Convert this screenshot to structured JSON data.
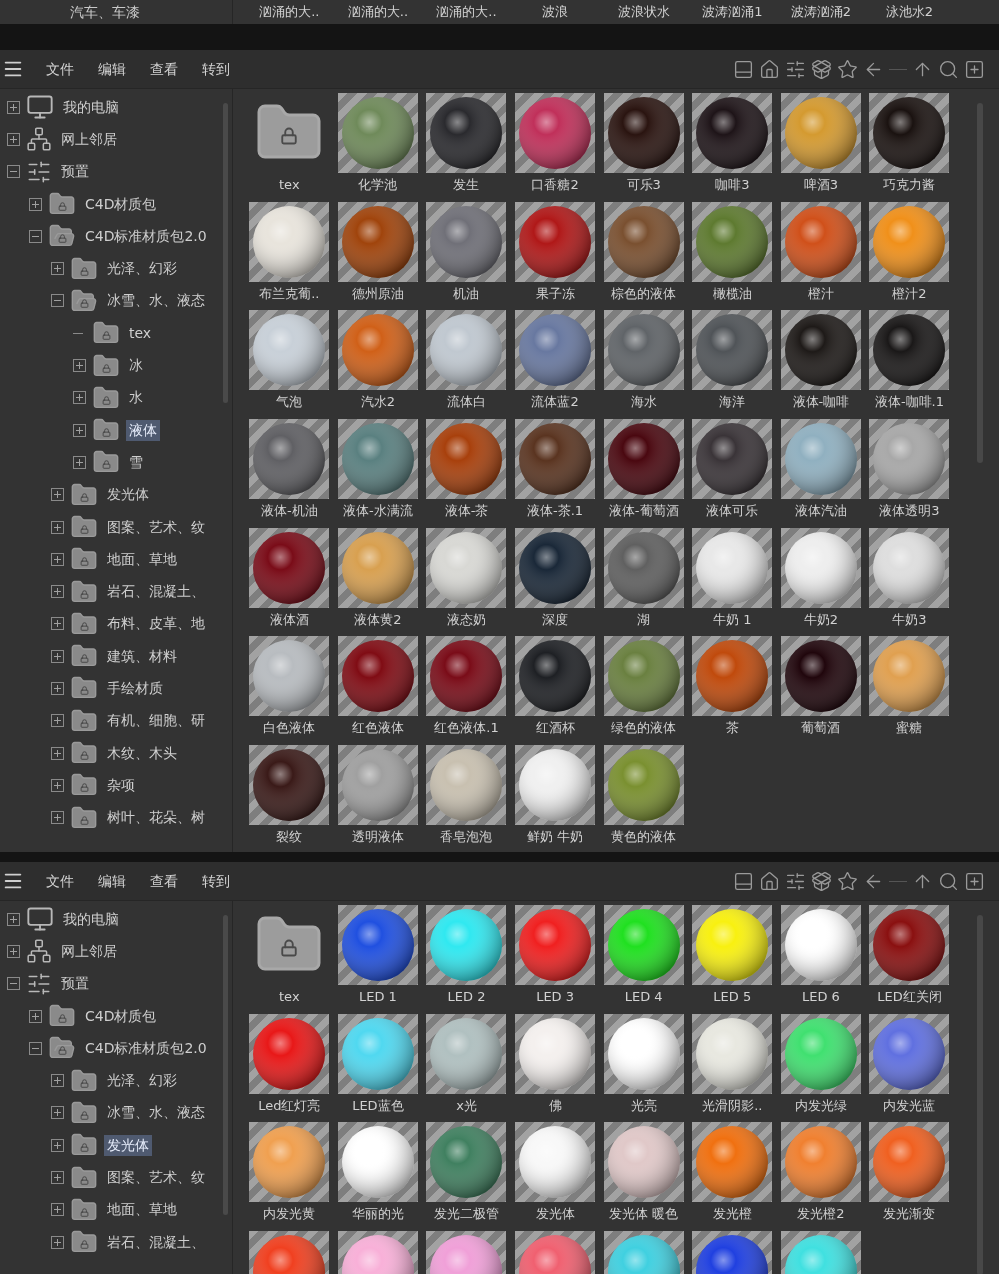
{
  "top_strip": {
    "tree_item": "汽车、车漆",
    "labels": [
      "汹涌的大..",
      "汹涌的大..",
      "汹涌的大..",
      "波浪",
      "波浪状水",
      "波涛汹涌1",
      "波涛汹涌2",
      "泳池水2"
    ]
  },
  "panels": [
    {
      "menu": [
        "文件",
        "编辑",
        "查看",
        "转到"
      ],
      "tree": [
        {
          "label": "我的电脑",
          "kind": "computer",
          "expandable": true,
          "expanded": false,
          "selected": false
        },
        {
          "label": "网上邻居",
          "kind": "network",
          "expandable": true,
          "expanded": false,
          "selected": false
        },
        {
          "label": "预置",
          "kind": "presets",
          "expandable": true,
          "expanded": true,
          "selected": false,
          "children": [
            {
              "label": "C4D材质包",
              "kind": "folder",
              "expandable": true,
              "expanded": false,
              "selected": false
            },
            {
              "label": "C4D标准材质包2.0",
              "kind": "folder",
              "expandable": true,
              "expanded": true,
              "selected": false,
              "children": [
                {
                  "label": "光泽、幻彩",
                  "kind": "folder",
                  "expandable": true,
                  "expanded": false,
                  "selected": false
                },
                {
                  "label": "冰雪、水、液态",
                  "kind": "folder",
                  "expandable": true,
                  "expanded": true,
                  "selected": false,
                  "children": [
                    {
                      "label": "tex",
                      "kind": "folder",
                      "expandable": false,
                      "expanded": false,
                      "selected": false
                    },
                    {
                      "label": "冰",
                      "kind": "folder",
                      "expandable": true,
                      "expanded": false,
                      "selected": false
                    },
                    {
                      "label": "水",
                      "kind": "folder",
                      "expandable": true,
                      "expanded": false,
                      "selected": false
                    },
                    {
                      "label": "液体",
                      "kind": "folder",
                      "expandable": true,
                      "expanded": false,
                      "selected": true
                    },
                    {
                      "label": "雪",
                      "kind": "folder",
                      "expandable": true,
                      "expanded": false,
                      "selected": false
                    }
                  ]
                },
                {
                  "label": "发光体",
                  "kind": "folder",
                  "expandable": true,
                  "expanded": false,
                  "selected": false
                },
                {
                  "label": "图案、艺术、纹",
                  "kind": "folder",
                  "expandable": true,
                  "expanded": false,
                  "selected": false
                },
                {
                  "label": "地面、草地",
                  "kind": "folder",
                  "expandable": true,
                  "expanded": false,
                  "selected": false
                },
                {
                  "label": "岩石、混凝土、",
                  "kind": "folder",
                  "expandable": true,
                  "expanded": false,
                  "selected": false
                },
                {
                  "label": "布料、皮革、地",
                  "kind": "folder",
                  "expandable": true,
                  "expanded": false,
                  "selected": false
                },
                {
                  "label": "建筑、材料",
                  "kind": "folder",
                  "expandable": true,
                  "expanded": false,
                  "selected": false
                },
                {
                  "label": "手绘材质",
                  "kind": "folder",
                  "expandable": true,
                  "expanded": false,
                  "selected": false
                },
                {
                  "label": "有机、细胞、研",
                  "kind": "folder",
                  "expandable": true,
                  "expanded": false,
                  "selected": false
                },
                {
                  "label": "木纹、木头",
                  "kind": "folder",
                  "expandable": true,
                  "expanded": false,
                  "selected": false
                },
                {
                  "label": "杂项",
                  "kind": "folder",
                  "expandable": true,
                  "expanded": false,
                  "selected": false
                },
                {
                  "label": "树叶、花朵、树",
                  "kind": "folder",
                  "expandable": true,
                  "expanded": false,
                  "selected": false
                }
              ]
            }
          ]
        }
      ],
      "grid": [
        {
          "name": "tex",
          "kind": "folder"
        },
        {
          "name": "化学池",
          "kind": "material",
          "color": "#6f8a5a"
        },
        {
          "name": "发生",
          "kind": "material",
          "color": "#2a2a2e"
        },
        {
          "name": "口香糖2",
          "kind": "material",
          "color": "#c0305a"
        },
        {
          "name": "可乐3",
          "kind": "material",
          "color": "#2a1410"
        },
        {
          "name": "咖啡3",
          "kind": "material",
          "color": "#1e1418"
        },
        {
          "name": "啤酒3",
          "kind": "material",
          "color": "#d49a30"
        },
        {
          "name": "巧克力酱",
          "kind": "material",
          "color": "#1a1210"
        },
        {
          "name": "布兰克葡..",
          "kind": "material",
          "color": "#e8e4dc"
        },
        {
          "name": "德州原油",
          "kind": "material",
          "color": "#a0440c"
        },
        {
          "name": "机油",
          "kind": "material",
          "color": "#707078"
        },
        {
          "name": "果子冻",
          "kind": "material",
          "color": "#b01818"
        },
        {
          "name": "棕色的液体",
          "kind": "material",
          "color": "#7a5030"
        },
        {
          "name": "橄榄油",
          "kind": "material",
          "color": "#5e7a30"
        },
        {
          "name": "橙汁",
          "kind": "material",
          "color": "#d0501a"
        },
        {
          "name": "橙汁2",
          "kind": "material",
          "color": "#f0901a"
        },
        {
          "name": "气泡",
          "kind": "material",
          "color": "#c8d0d8"
        },
        {
          "name": "汽水2",
          "kind": "material",
          "color": "#d06018"
        },
        {
          "name": "流体白",
          "kind": "material",
          "color": "#c0c8d0"
        },
        {
          "name": "流体蓝2",
          "kind": "material",
          "color": "#6878a0"
        },
        {
          "name": "海水",
          "kind": "material",
          "color": "#606468"
        },
        {
          "name": "海洋",
          "kind": "material",
          "color": "#505458"
        },
        {
          "name": "液体-咖啡",
          "kind": "material",
          "color": "#1e1a18"
        },
        {
          "name": "液体-咖啡.1",
          "kind": "material",
          "color": "#1a1818"
        },
        {
          "name": "液体-机油",
          "kind": "material",
          "color": "#606064"
        },
        {
          "name": "液体-水满流",
          "kind": "material",
          "color": "#5a8080"
        },
        {
          "name": "液体-茶",
          "kind": "material",
          "color": "#a8400c"
        },
        {
          "name": "液体-茶.1",
          "kind": "material",
          "color": "#5a3420"
        },
        {
          "name": "液体-葡萄酒",
          "kind": "material",
          "color": "#4a0810"
        },
        {
          "name": "液体可乐",
          "kind": "material",
          "color": "#3a3438"
        },
        {
          "name": "液体汽油",
          "kind": "material",
          "color": "#90b0c0"
        },
        {
          "name": "液体透明3",
          "kind": "material",
          "color": "#a8a8a8"
        },
        {
          "name": "液体酒",
          "kind": "material",
          "color": "#7a0c18"
        },
        {
          "name": "液体黄2",
          "kind": "material",
          "color": "#d8a050"
        },
        {
          "name": "液态奶",
          "kind": "material",
          "color": "#d8d8d4"
        },
        {
          "name": "深度",
          "kind": "material",
          "color": "#1a2838"
        },
        {
          "name": "湖",
          "kind": "material",
          "color": "#606060"
        },
        {
          "name": "牛奶 1",
          "kind": "material",
          "color": "#e8e8e8"
        },
        {
          "name": "牛奶2",
          "kind": "material",
          "color": "#eeeeee"
        },
        {
          "name": "牛奶3",
          "kind": "material",
          "color": "#dedede"
        },
        {
          "name": "白色液体",
          "kind": "material",
          "color": "#b8bcc0"
        },
        {
          "name": "红色液体",
          "kind": "material",
          "color": "#800c14"
        },
        {
          "name": "红色液体.1",
          "kind": "material",
          "color": "#7a0c18"
        },
        {
          "name": "红酒杯",
          "kind": "material",
          "color": "#1e2024"
        },
        {
          "name": "绿色的液体",
          "kind": "material",
          "color": "#6a8040"
        },
        {
          "name": "茶",
          "kind": "material",
          "color": "#c04a0c"
        },
        {
          "name": "葡萄酒",
          "kind": "material",
          "color": "#20060c"
        },
        {
          "name": "蜜糖",
          "kind": "material",
          "color": "#e0a050"
        },
        {
          "name": "裂纹",
          "kind": "material",
          "color": "#3a1a18"
        },
        {
          "name": "透明液体",
          "kind": "material",
          "color": "#a0a0a0"
        },
        {
          "name": "香皂泡泡",
          "kind": "material",
          "color": "#c8c0b0"
        },
        {
          "name": "鲜奶 牛奶",
          "kind": "material",
          "color": "#f0f0f0"
        },
        {
          "name": "黄色的液体",
          "kind": "material",
          "color": "#7a9030"
        }
      ]
    },
    {
      "menu": [
        "文件",
        "编辑",
        "查看",
        "转到"
      ],
      "tree": [
        {
          "label": "我的电脑",
          "kind": "computer",
          "expandable": true,
          "expanded": false,
          "selected": false
        },
        {
          "label": "网上邻居",
          "kind": "network",
          "expandable": true,
          "expanded": false,
          "selected": false
        },
        {
          "label": "预置",
          "kind": "presets",
          "expandable": true,
          "expanded": true,
          "selected": false,
          "children": [
            {
              "label": "C4D材质包",
              "kind": "folder",
              "expandable": true,
              "expanded": false,
              "selected": false
            },
            {
              "label": "C4D标准材质包2.0",
              "kind": "folder",
              "expandable": true,
              "expanded": true,
              "selected": false,
              "children": [
                {
                  "label": "光泽、幻彩",
                  "kind": "folder",
                  "expandable": true,
                  "expanded": false,
                  "selected": false
                },
                {
                  "label": "冰雪、水、液态",
                  "kind": "folder",
                  "expandable": true,
                  "expanded": false,
                  "selected": false
                },
                {
                  "label": "发光体",
                  "kind": "folder",
                  "expandable": true,
                  "expanded": false,
                  "selected": true
                },
                {
                  "label": "图案、艺术、纹",
                  "kind": "folder",
                  "expandable": true,
                  "expanded": false,
                  "selected": false
                },
                {
                  "label": "地面、草地",
                  "kind": "folder",
                  "expandable": true,
                  "expanded": false,
                  "selected": false
                },
                {
                  "label": "岩石、混凝土、",
                  "kind": "folder",
                  "expandable": true,
                  "expanded": false,
                  "selected": false
                }
              ]
            }
          ]
        }
      ],
      "grid": [
        {
          "name": "tex",
          "kind": "folder"
        },
        {
          "name": "LED 1",
          "kind": "material",
          "color": "#2050e0"
        },
        {
          "name": "LED 2",
          "kind": "material",
          "color": "#30e8f0"
        },
        {
          "name": "LED 3",
          "kind": "material",
          "color": "#f02020"
        },
        {
          "name": "LED 4",
          "kind": "material",
          "color": "#20e020"
        },
        {
          "name": "LED 5",
          "kind": "material",
          "color": "#f8f010"
        },
        {
          "name": "LED 6",
          "kind": "material",
          "color": "#ffffff"
        },
        {
          "name": "LED红关闭",
          "kind": "material",
          "color": "#8a1010"
        },
        {
          "name": "Led红灯亮",
          "kind": "material",
          "color": "#e81818"
        },
        {
          "name": "LED蓝色",
          "kind": "material",
          "color": "#50d8f0"
        },
        {
          "name": "x光",
          "kind": "material",
          "color": "#b0c0c0"
        },
        {
          "name": "佛",
          "kind": "material",
          "color": "#f4f0ee"
        },
        {
          "name": "光亮",
          "kind": "material",
          "color": "#ffffff"
        },
        {
          "name": "光滑阴影..",
          "kind": "material",
          "color": "#e8e8e0"
        },
        {
          "name": "内发光绿",
          "kind": "material",
          "color": "#40e070"
        },
        {
          "name": "内发光蓝",
          "kind": "material",
          "color": "#6070e0"
        },
        {
          "name": "内发光黄",
          "kind": "material",
          "color": "#f0a050"
        },
        {
          "name": "华丽的光",
          "kind": "material",
          "color": "#ffffff"
        },
        {
          "name": "发光二极管",
          "kind": "material",
          "color": "#408060"
        },
        {
          "name": "发光体",
          "kind": "material",
          "color": "#f8f8f8"
        },
        {
          "name": "发光体 暖色",
          "kind": "material",
          "color": "#e0c8c8"
        },
        {
          "name": "发光橙",
          "kind": "material",
          "color": "#f07010"
        },
        {
          "name": "发光橙2",
          "kind": "material",
          "color": "#f08030"
        },
        {
          "name": "发光渐变",
          "kind": "material",
          "color": "#f06020"
        },
        {
          "kind": "material",
          "color": "#f04020"
        },
        {
          "kind": "material",
          "color": "#f8b0d8"
        },
        {
          "kind": "material",
          "color": "#f0a0d8"
        },
        {
          "kind": "material",
          "color": "#f06070"
        },
        {
          "kind": "material",
          "color": "#40d0e0"
        },
        {
          "kind": "material",
          "color": "#2040e0"
        },
        {
          "kind": "material",
          "color": "#40e0e0"
        }
      ]
    }
  ]
}
